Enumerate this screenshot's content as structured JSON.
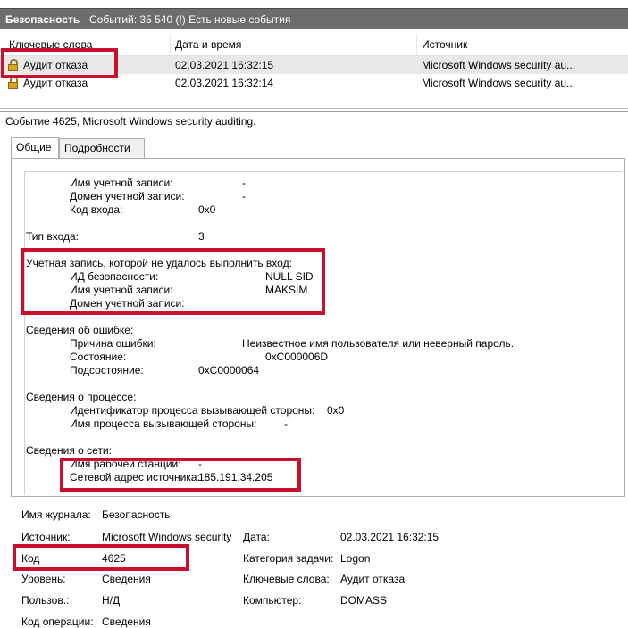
{
  "header": {
    "title": "Безопасность",
    "count": "Событий: 35 540 (!) Есть новые события"
  },
  "list": {
    "columns": [
      "Ключевые слова",
      "Дата и время",
      "Источник"
    ],
    "rows": [
      {
        "keyword": "Аудит отказа",
        "datetime": "02.03.2021 16:32:15",
        "source": "Microsoft Windows security au..."
      },
      {
        "keyword": "Аудит отказа",
        "datetime": "02.03.2021 16:32:14",
        "source": "Microsoft Windows security au..."
      }
    ]
  },
  "event": {
    "title": "Событие 4625, Microsoft Windows security auditing."
  },
  "tabs": [
    "Общие",
    "Подробности"
  ],
  "details": {
    "acct_name_label": "Имя учетной записи:",
    "acct_name_val": "-",
    "acct_domain_label": "Домен учетной записи:",
    "acct_domain_val": "-",
    "logon_code_label": "Код входа:",
    "logon_code_val": "0x0",
    "logon_type_label": "Тип входа:",
    "logon_type_val": "3",
    "failed_acct_label": "Учетная запись, которой не удалось выполнить вход:",
    "sid_label": "ИД безопасности:",
    "sid_val": "NULL SID",
    "failed_name_label": "Имя учетной записи:",
    "failed_name_val": "MAKSIM",
    "failed_domain_label": "Домен учетной записи:",
    "error_info_label": "Сведения об ошибке:",
    "reason_label": "Причина ошибки:",
    "reason_val": "Неизвестное имя пользователя или неверный пароль.",
    "status_label": "Состояние:",
    "status_val": "0xC000006D",
    "substatus_label": "Подсостояние:",
    "substatus_val": "0xC0000064",
    "process_info_label": "Сведения о процессе:",
    "caller_pid_label": "Идентификатор процесса вызывающей стороны:",
    "caller_pid_val": "0x0",
    "caller_name_label": "Имя процесса вызывающей стороны:",
    "caller_name_val": "-",
    "network_info_label": "Сведения о сети:",
    "workstation_label": "Имя рабочей станции:",
    "workstation_val": "-",
    "src_addr_label": "Сетевой адрес источника:",
    "src_addr_val": "185.191.34.205"
  },
  "summary": {
    "log_label": "Имя журнала:",
    "log_val": "Безопасность",
    "source_label": "Источник:",
    "source_val": "Microsoft Windows security",
    "date_label": "Дата:",
    "date_val": "02.03.2021 16:32:15",
    "code_label": "Код",
    "code_val": "4625",
    "category_label": "Категория задачи:",
    "category_val": "Logon",
    "level_label": "Уровень:",
    "level_val": "Сведения",
    "keywords_label": "Ключевые слова:",
    "keywords_val": "Аудит отказа",
    "user_label": "Пользов.:",
    "user_val": "Н/Д",
    "computer_label": "Компьютер:",
    "computer_val": "DOMASS",
    "opcode_label": "Код операции:",
    "opcode_val": "Сведения"
  },
  "colors": {
    "highlight": "#c8102e",
    "header_bar": "#6d6d6d"
  }
}
